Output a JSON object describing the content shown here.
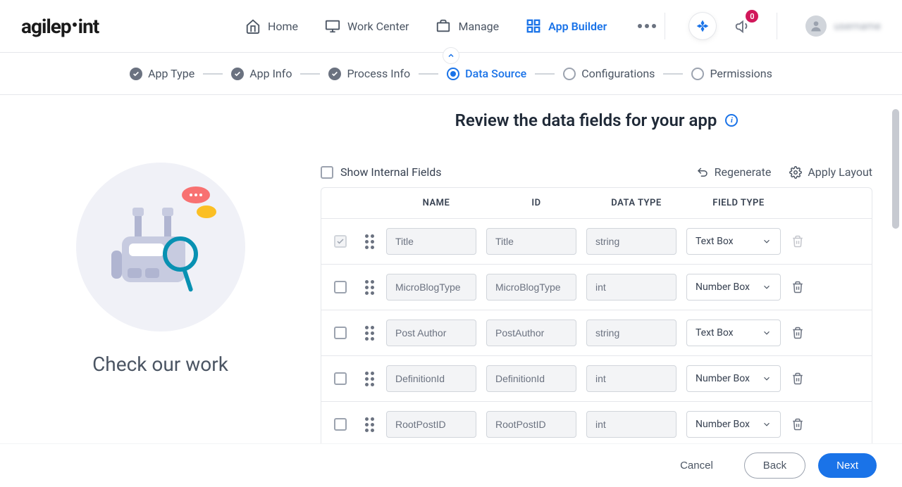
{
  "brand": "agilepoint",
  "nav": {
    "home": "Home",
    "work_center": "Work Center",
    "manage": "Manage",
    "app_builder": "App Builder"
  },
  "notifications_count": "0",
  "user_name": "username",
  "stepper": {
    "items": [
      {
        "label": "App Type",
        "state": "done"
      },
      {
        "label": "App Info",
        "state": "done"
      },
      {
        "label": "Process Info",
        "state": "done"
      },
      {
        "label": "Data Source",
        "state": "active"
      },
      {
        "label": "Configurations",
        "state": "pending"
      },
      {
        "label": "Permissions",
        "state": "pending"
      }
    ]
  },
  "left": {
    "title": "Check our work"
  },
  "page_title": "Review the data fields for your app",
  "toolbar": {
    "show_internal": "Show Internal Fields",
    "regenerate": "Regenerate",
    "apply_layout": "Apply Layout"
  },
  "table": {
    "headers": {
      "name": "NAME",
      "id": "ID",
      "datatype": "DATA TYPE",
      "fieldtype": "FIELD TYPE"
    },
    "rows": [
      {
        "checked": true,
        "locked": true,
        "name": "Title",
        "id": "Title",
        "datatype": "string",
        "fieldtype": "Text Box"
      },
      {
        "checked": false,
        "locked": false,
        "name": "MicroBlogType",
        "id": "MicroBlogType",
        "datatype": "int",
        "fieldtype": "Number Box"
      },
      {
        "checked": false,
        "locked": false,
        "name": "Post Author",
        "id": "PostAuthor",
        "datatype": "string",
        "fieldtype": "Text Box"
      },
      {
        "checked": false,
        "locked": false,
        "name": "DefinitionId",
        "id": "DefinitionId",
        "datatype": "int",
        "fieldtype": "Number Box"
      },
      {
        "checked": false,
        "locked": false,
        "name": "RootPostID",
        "id": "RootPostID",
        "datatype": "int",
        "fieldtype": "Number Box"
      }
    ]
  },
  "footer": {
    "cancel": "Cancel",
    "back": "Back",
    "next": "Next"
  }
}
